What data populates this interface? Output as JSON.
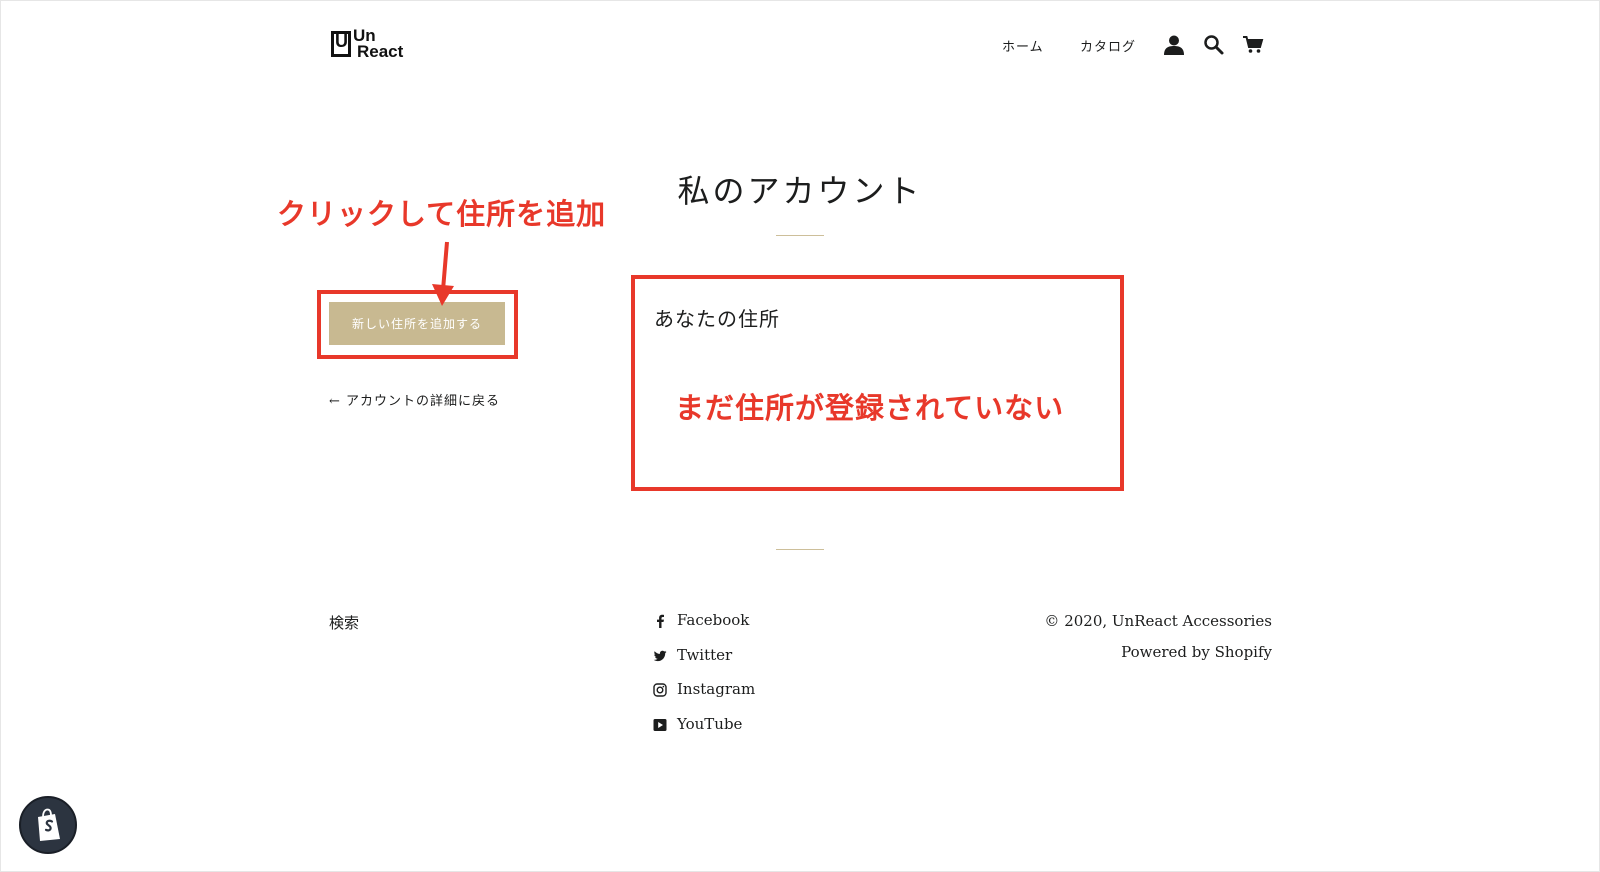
{
  "header": {
    "logo_line1": "Un",
    "logo_line2": "React",
    "logo_mark": "U",
    "nav": [
      {
        "label": "ホーム"
      },
      {
        "label": "カタログ"
      }
    ],
    "icons": [
      "user-icon",
      "search-icon",
      "cart-icon"
    ]
  },
  "main": {
    "title": "私のアカウント",
    "add_address_button": "新しい住所を追加する",
    "back_link": "← アカウントの詳細に戻る",
    "addresses_heading": "あなたの住所"
  },
  "annotations": {
    "click_to_add": "クリックして住所を追加",
    "no_address_yet": "まだ住所が登録されていない",
    "color": "#e8382a"
  },
  "footer": {
    "search_link": "検索",
    "social": [
      {
        "label": "Facebook",
        "icon": "facebook-icon"
      },
      {
        "label": "Twitter",
        "icon": "twitter-icon"
      },
      {
        "label": "Instagram",
        "icon": "instagram-icon"
      },
      {
        "label": "YouTube",
        "icon": "youtube-icon"
      }
    ],
    "copyright": "© 2020, UnReact Accessories",
    "powered_by": "Powered by Shopify"
  },
  "colors": {
    "button_bg": "#c8b991",
    "divider": "#cdbf9a",
    "text": "#1c1d1d"
  }
}
